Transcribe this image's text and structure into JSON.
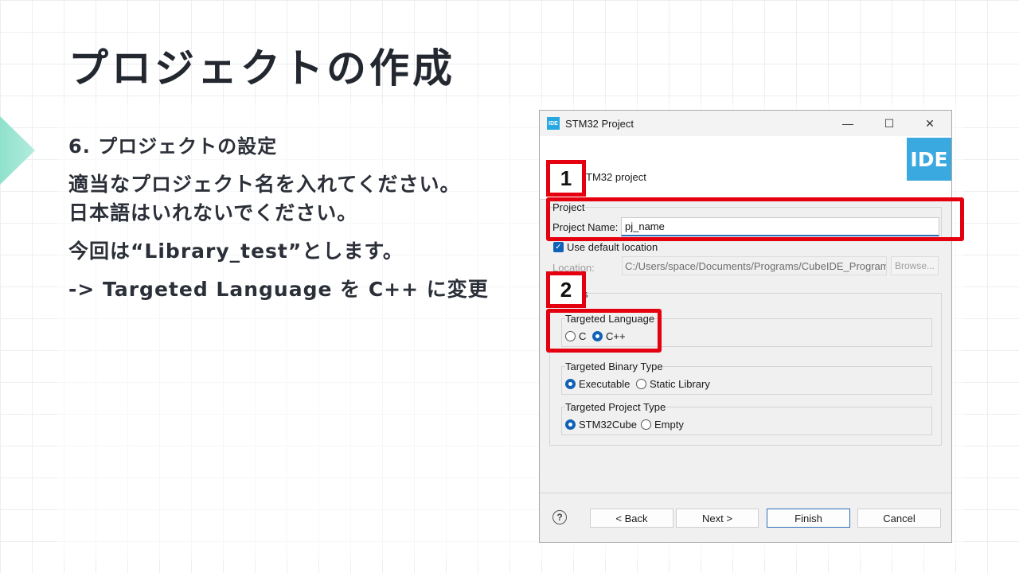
{
  "slide": {
    "title": "プロジェクトの作成",
    "step": "6. プロジェクトの設定",
    "lines": [
      "適当なプロジェクト名を入れてください。",
      "日本語はいれないでください。",
      "今回は“Library_test”とします。",
      "-> Targeted Language を C++ に変更"
    ]
  },
  "dialog": {
    "app_icon": "IDE",
    "title": "STM32 Project",
    "header_text": "TM32 project",
    "logo": "IDE",
    "project_group": "Project",
    "project_name_label": "Project Name:",
    "project_name_value": "pj_name",
    "use_default_location": "Use default location",
    "location_label": "Location:",
    "location_value": "C:/Users/space/Documents/Programs/CubeIDE_Program",
    "browse": "Browse...",
    "options_group": "s",
    "targeted_language": {
      "label": "Targeted Language",
      "options": [
        "C",
        "C++"
      ],
      "selected": "C++"
    },
    "targeted_binary_type": {
      "label": "Targeted Binary Type",
      "options": [
        "Executable",
        "Static Library"
      ],
      "selected": "Executable"
    },
    "targeted_project_type": {
      "label": "Targeted Project Type",
      "options": [
        "STM32Cube",
        "Empty"
      ],
      "selected": "STM32Cube"
    },
    "buttons": {
      "help": "?",
      "back": "< Back",
      "next": "Next >",
      "finish": "Finish",
      "cancel": "Cancel"
    },
    "window_controls": {
      "minimize": "—",
      "maximize": "☐",
      "close": "✕"
    }
  },
  "annotations": {
    "marker_1": "1",
    "marker_2": "2",
    "color": "#e4000f"
  },
  "colors": {
    "accent": "#8fe1cc",
    "selection_blue": "#0f62b5",
    "ide_logo": "#39a9e0"
  }
}
